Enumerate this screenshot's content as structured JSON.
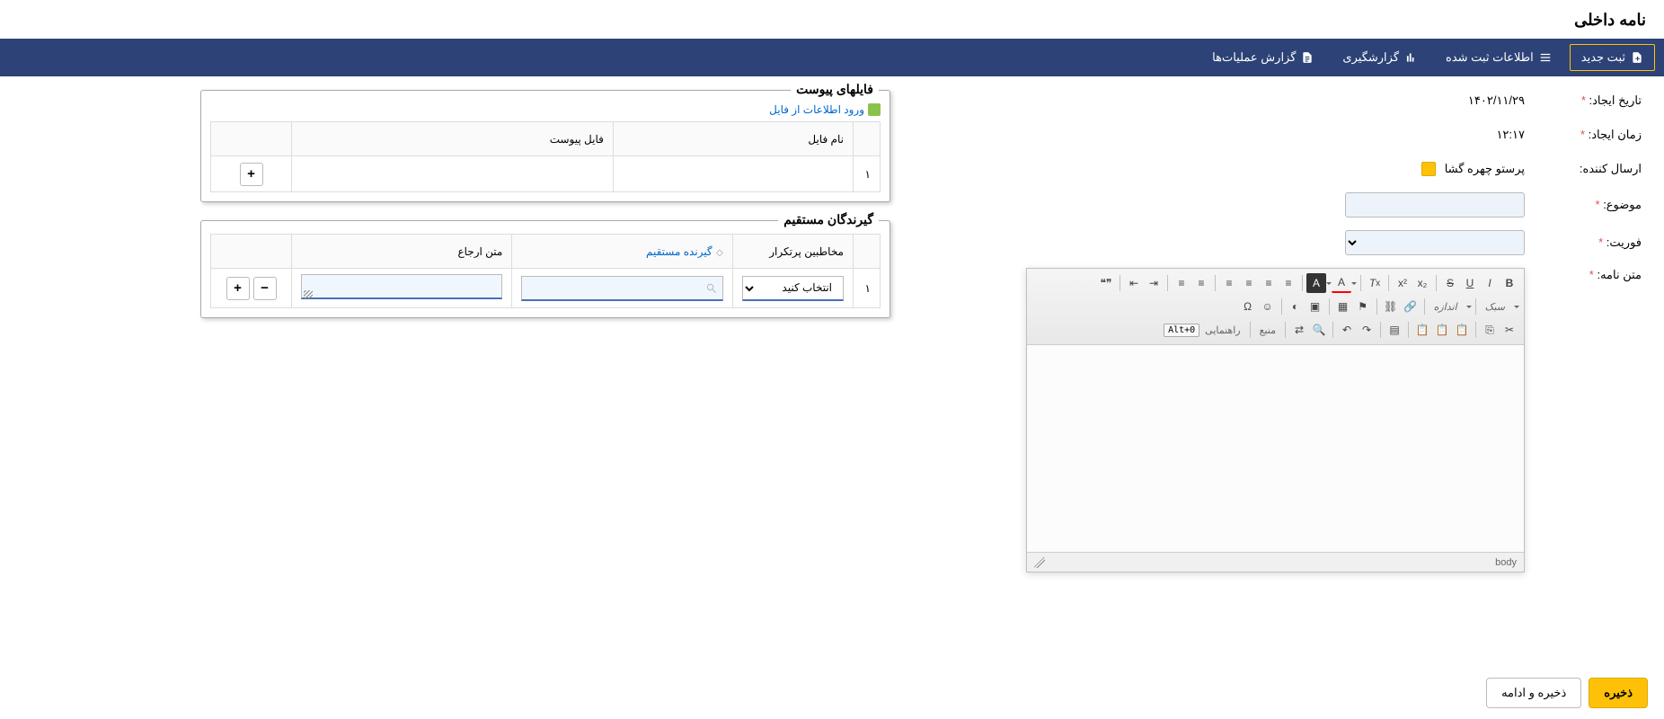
{
  "page": {
    "title": "نامه داخلی"
  },
  "toolbar": {
    "new": "ثبت جدید",
    "registered": "اطلاعات ثبت شده",
    "reporting": "گزارشگیری",
    "oplog": "گزارش عملیات‌ها"
  },
  "form": {
    "labels": {
      "create_date": "تاریخ ایجاد:",
      "create_time": "زمان ایجاد:",
      "sender": "ارسال کننده:",
      "subject": "موضوع:",
      "priority": "فوریت:",
      "body": "متن نامه:"
    },
    "values": {
      "create_date": "۱۴۰۲/۱۱/۲۹",
      "create_time": "۱۲:۱۷",
      "sender": "پرستو چهره گشا"
    }
  },
  "editor": {
    "style_dd": "سبک",
    "size_dd": "اندازه",
    "source_btn": "منبع",
    "help_btn": "راهنمایی",
    "shortcut": "Alt+0",
    "status": "body"
  },
  "attachments_panel": {
    "title": "فایلهای پیوست",
    "import_link": "ورود اطلاعات از فایل",
    "columns": {
      "name": "نام فایل",
      "file": "فایل پیوست"
    },
    "rows": [
      {
        "idx": "۱"
      }
    ]
  },
  "recipients_panel": {
    "title": "گیرندگان مستقیم",
    "columns": {
      "freq": "مخاطبین پرتکرار",
      "direct": "گیرنده مستقیم",
      "note": "متن ارجاع"
    },
    "select_placeholder": "انتخاب کنید",
    "rows": [
      {
        "idx": "۱"
      }
    ]
  },
  "footer": {
    "save": "ذخیره",
    "save_continue": "ذخیره و ادامه"
  }
}
